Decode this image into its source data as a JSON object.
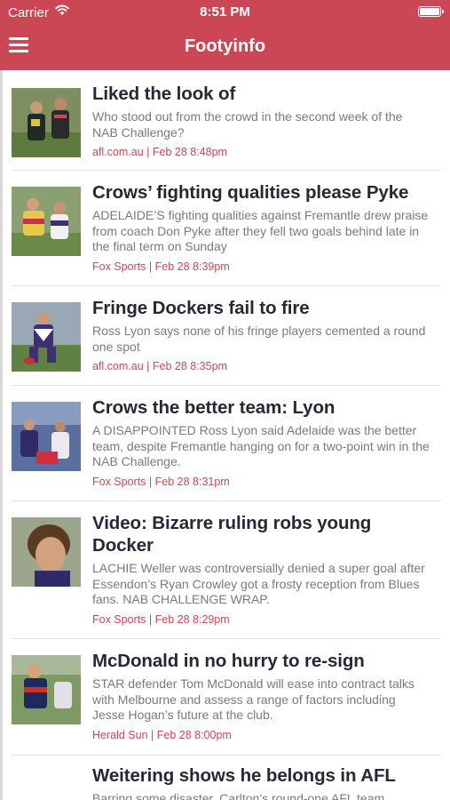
{
  "status_bar": {
    "carrier": "Carrier",
    "time": "8:51 PM"
  },
  "header": {
    "title": "Footyinfo",
    "menu_icon": "hamburger-menu-icon"
  },
  "colors": {
    "brand": "#cb4755",
    "headline": "#262836",
    "summary": "#7a7a7a",
    "meta": "#cb4755"
  },
  "articles": [
    {
      "title": "Liked the look of",
      "summary": "Who stood out from the crowd in the second week of the NAB Challenge?",
      "meta": "afl.com.au | Feb 28 8:48pm"
    },
    {
      "title": "Crows’ fighting qualities please Pyke",
      "summary": "ADELAIDE’S fighting qualities against Fremantle drew praise from coach Don Pyke after they fell two goals behind late in the final term on Sunday",
      "meta": "Fox Sports | Feb 28 8:39pm"
    },
    {
      "title": "Fringe Dockers fail to fire",
      "summary": "Ross Lyon says none of his fringe players cemented a round one spot",
      "meta": "afl.com.au | Feb 28 8:35pm"
    },
    {
      "title": "Crows the better team: Lyon",
      "summary": "A DISAPPOINTED Ross Lyon said Adelaide was the better team, despite Fremantle hanging on for a two-point win in the NAB Challenge.",
      "meta": "Fox Sports | Feb 28 8:31pm"
    },
    {
      "title": "Video: Bizarre ruling robs young Docker",
      "summary": "LACHIE Weller was controversially denied a super goal after Essendon’s Ryan Crowley got a frosty reception from Blues fans. NAB CHALLENGE WRAP.",
      "meta": "Fox Sports | Feb 28 8:29pm"
    },
    {
      "title": "McDonald in no hurry to re-sign",
      "summary": "STAR defender Tom McDonald will ease into contract talks with Melbourne and assess a range of factors including Jesse Hogan’s future at the club.",
      "meta": "Herald Sun | Feb 28 8:00pm"
    },
    {
      "title": "Weitering shows he belongs in AFL",
      "summary": "Barring some disaster, Carlton’s round-one AFL team",
      "meta": ""
    }
  ]
}
